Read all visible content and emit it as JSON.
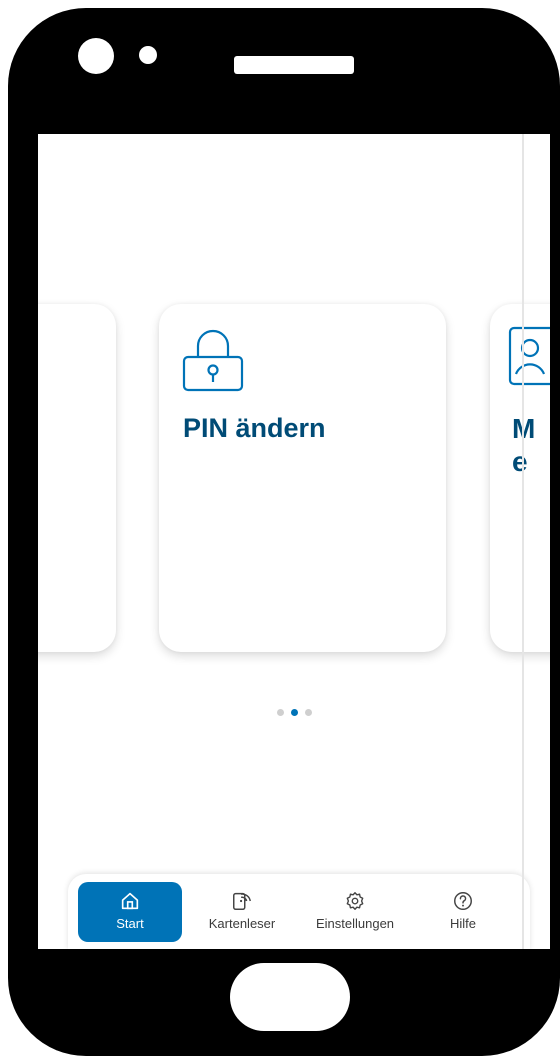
{
  "cards": {
    "center": {
      "icon": "lock-icon",
      "title": "PIN ändern"
    },
    "right": {
      "icon": "id-card-icon",
      "title_line1": "M",
      "title_line2": "e"
    }
  },
  "pager": {
    "pages": 3,
    "active_index": 1
  },
  "nav": {
    "items": [
      {
        "label": "Start",
        "icon": "home-icon",
        "active": true
      },
      {
        "label": "Kartenleser",
        "icon": "card-reader-icon",
        "active": false
      },
      {
        "label": "Einstellungen",
        "icon": "gear-icon",
        "active": false
      },
      {
        "label": "Hilfe",
        "icon": "help-icon",
        "active": false
      }
    ]
  },
  "colors": {
    "accent": "#0073b7",
    "title": "#004b76",
    "phone_frame": "#000000",
    "dot_inactive": "#cfcfcf"
  }
}
